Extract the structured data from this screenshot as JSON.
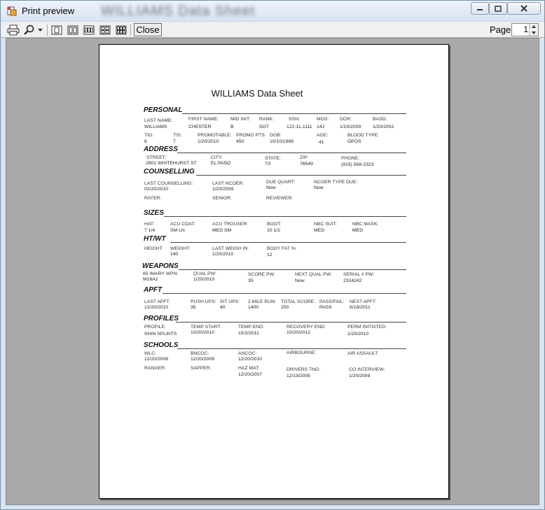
{
  "window": {
    "title": "Print preview",
    "blurred_title": "WILLIAMS Data Sheet",
    "controls": [
      "minimize",
      "maximize",
      "close"
    ]
  },
  "toolbar": {
    "icons": [
      "printer-icon",
      "zoom-icon",
      "dropdown-arrow-icon",
      "one-page-icon",
      "two-pages-icon",
      "three-pages-icon",
      "four-pages-icon",
      "six-pages-icon"
    ],
    "close_label": "Close",
    "page_label": "Page",
    "page_value": "1"
  },
  "document": {
    "title": "WILLIAMS Data Sheet",
    "sections": [
      {
        "id": "personal",
        "title": "PERSONAL",
        "fields": [
          {
            "label": "LAST NAME:",
            "value": "WILLIAMS"
          },
          {
            "label": "FIRST NAME:",
            "value": "CHESTER"
          },
          {
            "label": "MID INIT:",
            "value": "B"
          },
          {
            "label": "RANK:",
            "value": "SGT"
          },
          {
            "label": "SSN:",
            "value": "122-11-1111"
          },
          {
            "label": "MOS:",
            "value": "14J"
          },
          {
            "label": "DOR:",
            "value": "1/10/2009"
          },
          {
            "label": "BASD:",
            "value": "1/20/2002"
          },
          {
            "label": "TIG:",
            "value": "6"
          },
          {
            "label": "TIS:",
            "value": "7"
          },
          {
            "label": "PROMOTABLE:",
            "value": "1/20/2010"
          },
          {
            "label": "PROMO PTS:",
            "value": "450"
          },
          {
            "label": "DOB:",
            "value": "10/10/1969"
          },
          {
            "label": "AGE:",
            "value": "41"
          },
          {
            "label": "BLOOD TYPE:",
            "value": "OPOS"
          }
        ]
      },
      {
        "id": "address",
        "title": "ADDRESS",
        "fields": [
          {
            "label": "STREET:",
            "value": "2901 WHITEHURST ST"
          },
          {
            "label": "CITY:",
            "value": "EL PASO"
          },
          {
            "label": "STATE:",
            "value": "TX"
          },
          {
            "label": "ZIP:",
            "value": "76549"
          },
          {
            "label": "PHONE:",
            "value": "(915) 568-2323"
          }
        ]
      },
      {
        "id": "counselling",
        "title": "COUNSELLING",
        "fields": [
          {
            "label": "LAST COUNSELLING:",
            "value": "02/20/2010"
          },
          {
            "label": "LAST NCOER:",
            "value": "1/20/2009"
          },
          {
            "label": "DUE QUART:",
            "value": "Now"
          },
          {
            "label": "NCOER TYPE DUE:",
            "value": "Now"
          },
          {
            "label": "RATER:",
            "value": ""
          },
          {
            "label": "SENIOR:",
            "value": ""
          },
          {
            "label": "REVIEWER:",
            "value": ""
          }
        ]
      },
      {
        "id": "sizes",
        "title": "SIZES",
        "fields": [
          {
            "label": "HAT:",
            "value": "7 1/4"
          },
          {
            "label": "ACU COAT:",
            "value": "SM LN"
          },
          {
            "label": "ACU TROUSER:",
            "value": "MED SM"
          },
          {
            "label": "BOOT:",
            "value": "10 1/2"
          },
          {
            "label": "NBC SUIT:",
            "value": "MED"
          },
          {
            "label": "NBC MASK:",
            "value": "MED"
          }
        ]
      },
      {
        "id": "htwt",
        "title": "HT/WT",
        "fields": [
          {
            "label": "HEIGHT:",
            "value": ""
          },
          {
            "label": "WEIGHT:",
            "value": "140"
          },
          {
            "label": "LAST WEIGH IN:",
            "value": "1/20/2010"
          },
          {
            "label": "BODY FAT %:",
            "value": "12"
          }
        ]
      },
      {
        "id": "weapons",
        "title": "WEAPONS",
        "fields": [
          {
            "label": "65 IMARY WPN:",
            "value": "M16A2"
          },
          {
            "label": "QUAL PW:",
            "value": "1/20/2010"
          },
          {
            "label": "SCORE PW:",
            "value": "35"
          },
          {
            "label": "NEXT QUAL PW:",
            "value": "Now"
          },
          {
            "label": "SERIAL # PW:",
            "value": "2324242"
          }
        ]
      },
      {
        "id": "apft",
        "title": "APFT",
        "fields": [
          {
            "label": "LAST APFT:",
            "value": "12/20/2010"
          },
          {
            "label": "PUSH UPS:",
            "value": "35"
          },
          {
            "label": "SIT UPS:",
            "value": "40"
          },
          {
            "label": "2 MILE RUN:",
            "value": "1400"
          },
          {
            "label": "TOTAL SCORE:",
            "value": "200"
          },
          {
            "label": "PASS/FAIL:",
            "value": "PASS"
          },
          {
            "label": "NEXT APFT:",
            "value": "6/18/2011"
          }
        ]
      },
      {
        "id": "profiles",
        "title": "PROFILES",
        "fields": [
          {
            "label": "PROFILE:",
            "value": "SHIN SPLINTS"
          },
          {
            "label": "TEMP START:",
            "value": "10/20/2010"
          },
          {
            "label": "TEMP END:",
            "value": "10/2/2011"
          },
          {
            "label": "RECOVERY END:",
            "value": "10/20/2012"
          },
          {
            "label": "PERM INITIATED:",
            "value": "1/20/2010"
          }
        ]
      },
      {
        "id": "schools",
        "title": "SCHOOLS",
        "fields": [
          {
            "label": "WLC:",
            "value": "12/20/2008"
          },
          {
            "label": "BNCOC:",
            "value": "12/20/2009"
          },
          {
            "label": "ANCOC:",
            "value": "12/20/2010"
          },
          {
            "label": "AIRBOURNE:",
            "value": ""
          },
          {
            "label": "AIR ASSAULT:",
            "value": ""
          },
          {
            "label": "RANGER:",
            "value": ""
          },
          {
            "label": "SAPPER:",
            "value": ""
          },
          {
            "label": "HAZ MAT:",
            "value": "12/20/2007"
          },
          {
            "label": "DRIVERS TNG:",
            "value": "12/19/2005"
          },
          {
            "label": "CO INTERVIEW:",
            "value": "1/20/2009"
          }
        ]
      }
    ]
  }
}
